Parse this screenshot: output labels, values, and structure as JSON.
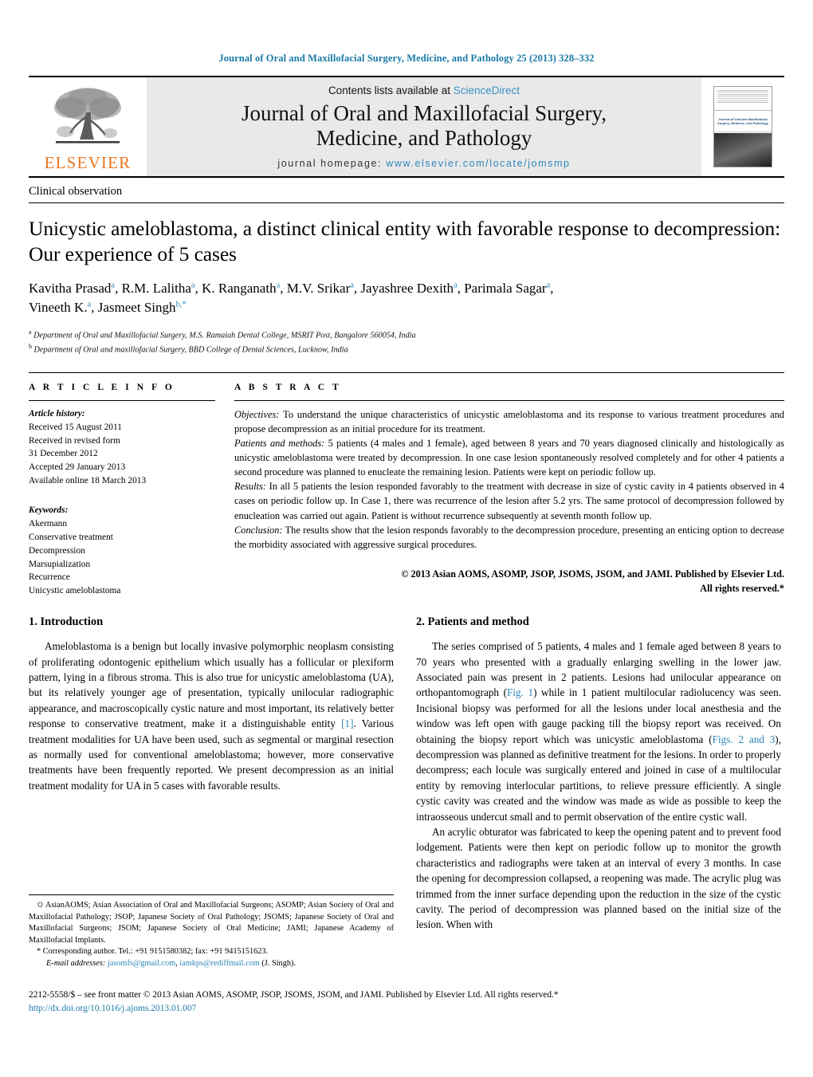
{
  "running_head": "Journal of Oral and Maxillofacial Surgery, Medicine, and Pathology 25 (2013) 328–332",
  "masthead": {
    "publisher_name": "ELSEVIER",
    "contents_prefix": "Contents lists available at ",
    "contents_link": "ScienceDirect",
    "journal_title_line1": "Journal of Oral and Maxillofacial Surgery,",
    "journal_title_line2": "Medicine, and Pathology",
    "homepage_label": "journal homepage:",
    "homepage_url": "www.elsevier.com/locate/jomsmp",
    "cover_title": "Journal of Oral and Maxillofacial Surgery, Medicine, and Pathology"
  },
  "article": {
    "type": "Clinical observation",
    "title": "Unicystic ameloblastoma, a distinct clinical entity with favorable response to decompression: Our experience of 5 cases",
    "authors_line1": "Kavitha Prasad",
    "authors": "Kavitha Prasad a, R.M. Lalitha a, K. Ranganath a, M.V. Srikar a, Jayashree Dexith a, Parimala Sagar a, Vineeth K. a, Jasmeet Singh b,*",
    "affiliation_a": "Department of Oral and Maxillofacial Surgery, M.S. Ramaiah Dental College, MSRIT Post, Bangalore 560054, India",
    "affiliation_b": "Department of Oral and maxillofacial Surgery, BBD College of Dental Sciences, Lucknow, India"
  },
  "article_info": {
    "label": "A R T I C L E    I N F O",
    "history_label": "Article history:",
    "history": [
      "Received 15 August 2011",
      "Received in revised form",
      "31 December 2012",
      "Accepted 29 January 2013",
      "Available online 18 March 2013"
    ],
    "keywords_label": "Keywords:",
    "keywords": [
      "Akermann",
      "Conservative treatment",
      "Decompression",
      "Marsupialization",
      "Recurrence",
      "Unicystic ameloblastoma"
    ]
  },
  "abstract": {
    "label": "A B S T R A C T",
    "objectives_label": "Objectives:",
    "objectives_text": " To understand the unique characteristics of unicystic ameloblastoma and its response to various treatment procedures and propose decompression as an initial procedure for its treatment.",
    "patients_label": "Patients and methods:",
    "patients_text": " 5 patients (4 males and 1 female), aged between 8 years and 70 years diagnosed clinically and histologically as unicystic ameloblastoma were treated by decompression. In one case lesion spontaneously resolved completely and for other 4 patients a second procedure was planned to enucleate the remaining lesion. Patients were kept on periodic follow up.",
    "results_label": "Results:",
    "results_text": " In all 5 patients the lesion responded favorably to the treatment with decrease in size of cystic cavity in 4 patients observed in 4 cases on periodic follow up. In Case 1, there was recurrence of the lesion after 5.2 yrs. The same protocol of decompression followed by enucleation was carried out again. Patient is without recurrence subsequently at seventh month follow up.",
    "conclusion_label": "Conclusion:",
    "conclusion_text": " The results show that the lesion responds favorably to the decompression procedure, presenting an enticing option to decrease the morbidity associated with aggressive surgical procedures.",
    "copyright_line1": "© 2013 Asian AOMS, ASOMP, JSOP, JSOMS, JSOM, and JAMI. Published by Elsevier Ltd.",
    "copyright_line2": "All rights reserved.*"
  },
  "sections": {
    "intro_heading": "1.  Introduction",
    "intro_p1_a": "Ameloblastoma is a benign but locally invasive polymorphic neoplasm consisting of proliferating odontogenic epithelium which usually has a follicular or plexiform pattern, lying in a fibrous stroma. This is also true for unicystic ameloblastoma (UA), but its relatively younger age of presentation, typically unilocular radiographic appearance, and macroscopically cystic nature and most important, its relatively better response to conservative treatment, make it a distinguishable entity ",
    "intro_ref1": "[1]",
    "intro_p1_b": ". Various treatment modalities for UA have been used, such as segmental or marginal resection as normally used for conventional ameloblastoma; however, more conservative treatments have been frequently reported. We present decompression as an initial treatment modality for UA in 5 cases with favorable results.",
    "methods_heading": "2.  Patients and method",
    "methods_p1_a": "The series comprised of 5 patients, 4 males and 1 female aged between 8 years to 70 years who presented with a gradually enlarging swelling in the lower jaw. Associated pain was present in 2 patients. Lesions had unilocular appearance on orthopantomograph (",
    "methods_fig1": "Fig. 1",
    "methods_p1_b": ") while in 1 patient multilocular radiolucency was seen. Incisional biopsy was performed for all the lesions under local anesthesia and the window was left open with gauge packing till the biopsy report was received. On obtaining the biopsy report which was unicystic ameloblastoma (",
    "methods_fig23": "Figs. 2 and 3",
    "methods_p1_c": "), decompression was planned as definitive treatment for the lesions. In order to properly decompress; each locule was surgically entered and joined in case of a multilocular entity by removing interlocular partitions, to relieve pressure efficiently. A single cystic cavity was created and the window was made as wide as possible to keep the intraosseous undercut small and to permit observation of the entire cystic wall.",
    "methods_p2": "An acrylic obturator was fabricated to keep the opening patent and to prevent food lodgement. Patients were then kept on periodic follow up to monitor the growth characteristics and radiographs were taken at an interval of every 3 months. In case the opening for decompression collapsed, a reopening was made. The acrylic plug was trimmed from the inner surface depending upon the reduction in the size of the cystic cavity. The period of decompression was planned based on the initial size of the lesion. When with"
  },
  "footnote": {
    "abbrev_marker": "✩",
    "abbreviations": " AsianAOMS; Asian Association of Oral and Maxillofacial Surgeons; ASOMP; Asian Society of Oral and Maxillofacial Pathology; JSOP; Japanese Society of Oral Pathology; JSOMS; Japanese Society of Oral and Maxillofacial Surgeons; JSOM; Japanese Society of Oral Medicine; JAMI; Japanese Academy of Maxillofacial Implants.",
    "corresponding_marker": "*",
    "corresponding": " Corresponding author. Tel.: +91 9151580382; fax: +91 9415151623.",
    "email_label": "E-mail addresses:",
    "email_1": "jasomfs@gmail.com",
    "email_2": "iamkps@rediffmail.com",
    "email_suffix": " (J. Singh)."
  },
  "bottom": {
    "issn_line": "2212-5558/$ – see front matter © 2013 Asian AOMS, ASOMP, JSOP, JSOMS, JSOM, and JAMI. Published by Elsevier Ltd. All rights reserved.*",
    "doi": "http://dx.doi.org/10.1016/j.ajoms.2013.01.007"
  },
  "colors": {
    "link_blue": "#2e86b8",
    "header_blue": "#1a7aa8",
    "elsevier_orange": "#E87722",
    "masthead_grey": "#e9e9e9"
  }
}
